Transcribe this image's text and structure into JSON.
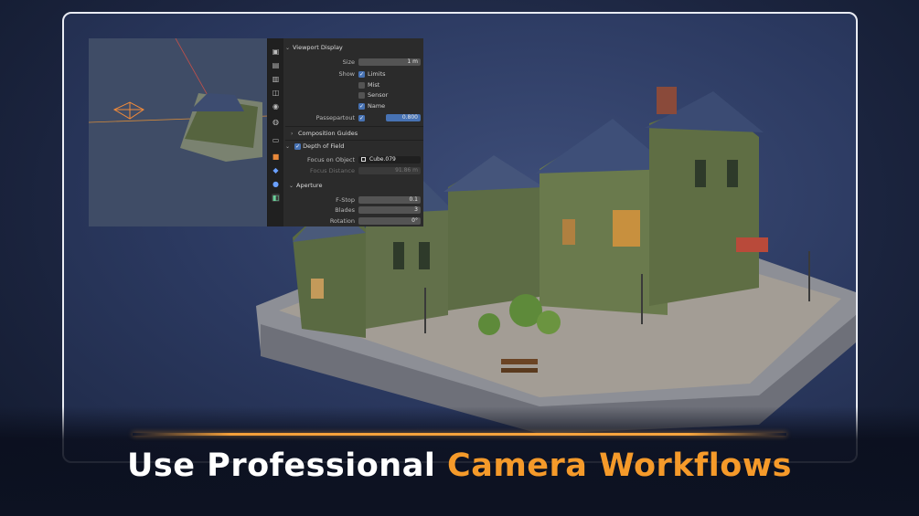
{
  "headline": {
    "part1": "Use Professional ",
    "part2": "Camera Workflows"
  },
  "colors": {
    "accent": "#f59a2a",
    "panel_bg": "#2b2b2b",
    "checkbox_on": "#4772b3"
  },
  "panel": {
    "toolbar_icons": [
      "tool-icon",
      "render-icon",
      "output-icon",
      "view-layer-icon",
      "scene-icon",
      "world-icon",
      "collection-icon",
      "object-icon",
      "modifier-icon",
      "physics-icon",
      "camera-data-icon"
    ],
    "viewport_display": {
      "header": "Viewport Display",
      "size_label": "Size",
      "size_value": "1 m",
      "show_label": "Show",
      "limits": "Limits",
      "mist": "Mist",
      "sensor": "Sensor",
      "name": "Name",
      "passepartout_label": "Passepartout",
      "passepartout_value": "0.800"
    },
    "composition_guides": {
      "header": "Composition Guides"
    },
    "depth_of_field": {
      "header": "Depth of Field",
      "focus_object_label": "Focus on Object",
      "focus_object_value": "Cube.079",
      "focus_distance_label": "Focus Distance",
      "focus_distance_value": "91.86 m"
    },
    "aperture": {
      "header": "Aperture",
      "fstop_label": "F-Stop",
      "fstop_value": "0.1",
      "blades_label": "Blades",
      "blades_value": "3",
      "rotation_label": "Rotation",
      "rotation_value": "0°"
    }
  }
}
